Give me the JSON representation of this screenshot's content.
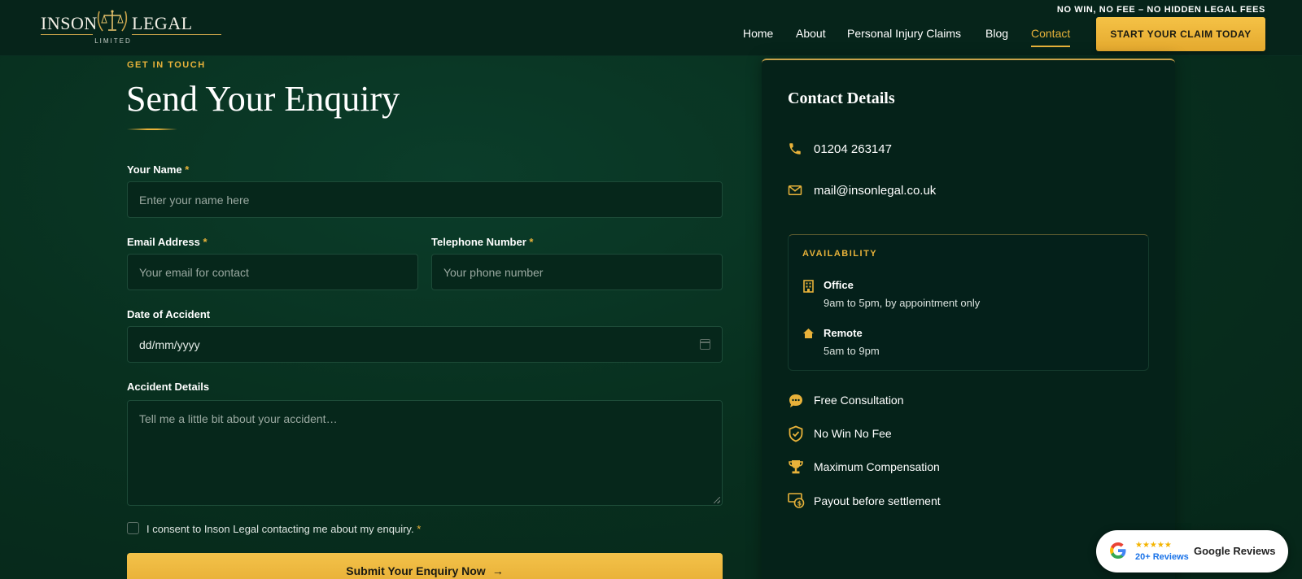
{
  "header": {
    "logo": {
      "word1": "INSON",
      "word2": "LEGAL",
      "sub": "LIMITED"
    },
    "tagline": "NO WIN, NO FEE – NO HIDDEN LEGAL FEES",
    "nav": [
      {
        "label": "Home",
        "active": false
      },
      {
        "label": "About",
        "active": false
      },
      {
        "label": "Personal Injury Claims",
        "active": false
      },
      {
        "label": "Blog",
        "active": false
      },
      {
        "label": "Contact",
        "active": true
      }
    ],
    "cta_label": "START YOUR CLAIM TODAY"
  },
  "form": {
    "eyebrow": "GET IN TOUCH",
    "title": "Send Your Enquiry",
    "name_label": "Your Name",
    "name_placeholder": "Enter your name here",
    "email_label": "Email Address",
    "email_placeholder": "Your email for contact",
    "phone_label": "Telephone Number",
    "phone_placeholder": "Your phone number",
    "date_label": "Date of Accident",
    "date_value": "dd/mm/yyyy",
    "details_label": "Accident Details",
    "details_placeholder": "Tell me a little bit about your accident…",
    "required_mark": "*",
    "consent_text": "I consent to Inson Legal contacting me about my enquiry.",
    "submit_label": "Submit Your Enquiry Now",
    "submit_arrow": "→"
  },
  "contact": {
    "title": "Contact Details",
    "phone": "01204 263147",
    "email": "mail@insonlegal.co.uk",
    "availability": {
      "title": "AVAILABILITY",
      "items": [
        {
          "name": "Office",
          "hours": "9am to 5pm, by appointment only",
          "icon": "building-icon"
        },
        {
          "name": "Remote",
          "hours": "5am to 9pm",
          "icon": "home-icon"
        }
      ]
    },
    "features": [
      {
        "label": "Free Consultation",
        "icon": "chat-bubble-icon"
      },
      {
        "label": "No Win No Fee",
        "icon": "shield-check-icon"
      },
      {
        "label": "Maximum Compensation",
        "icon": "trophy-icon"
      },
      {
        "label": "Payout before settlement",
        "icon": "money-icon"
      }
    ]
  },
  "reviews": {
    "stars": "★★★★★",
    "count": "20+ Reviews",
    "label": "Google Reviews"
  },
  "colors": {
    "accent_gold": "#e8b23a",
    "background_green": "#08301f",
    "header_green": "#06241a"
  }
}
